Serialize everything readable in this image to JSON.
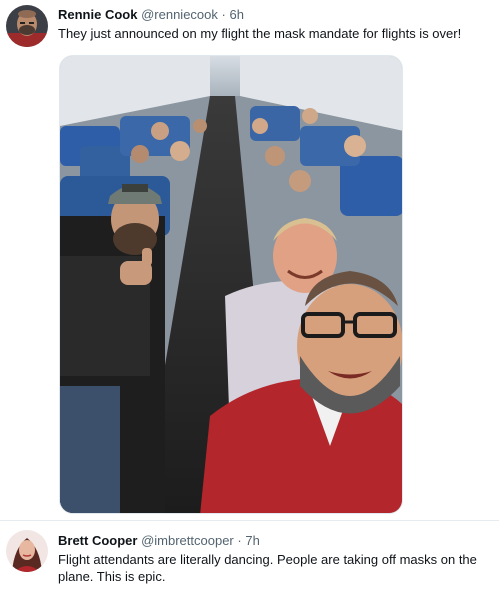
{
  "tweets": [
    {
      "display_name": "Rennie Cook",
      "handle": "@renniecook",
      "separator": "·",
      "time": "6h",
      "text": "They just announced on my flight the mask mandate for flights is over!",
      "avatar_icon": "avatar-photo-icon",
      "media_icon": "airplane-cabin-selfie-photo"
    },
    {
      "display_name": "Brett Cooper",
      "handle": "@imbrettcooper",
      "separator": "·",
      "time": "7h",
      "text": "Flight attendants are literally dancing. People are taking off masks on the plane. This is epic.",
      "avatar_icon": "avatar-photo-icon"
    }
  ],
  "colors": {
    "name": "#0f1419",
    "meta": "#536471",
    "divider": "#e6ecf0"
  }
}
